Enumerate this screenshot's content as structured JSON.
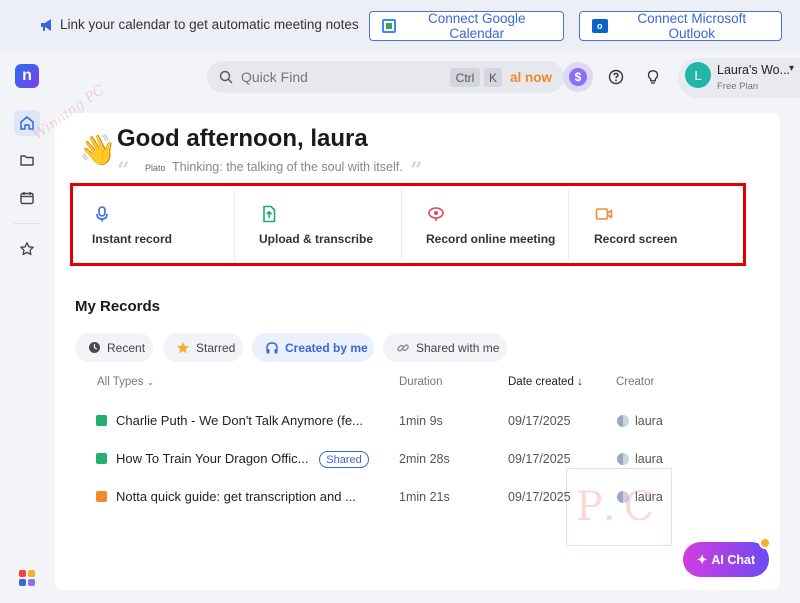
{
  "banner": {
    "text": "Link your calendar to get automatic meeting notes",
    "google_button": "Connect Google Calendar",
    "outlook_button": "Connect Microsoft Outlook"
  },
  "brand": {
    "logo_letter": "n"
  },
  "search": {
    "placeholder": "Quick Find",
    "shortcut_ctrl": "Ctrl",
    "shortcut_k": "K",
    "promo": "al now"
  },
  "user": {
    "initial": "L",
    "name": "Laura's Wo...",
    "plan": "Free Plan"
  },
  "greeting": {
    "title": "Good afternoon, laura",
    "quote_author": "Plato",
    "quote_text": "Thinking: the talking of the soul with itself."
  },
  "actions": [
    {
      "label": "Instant record",
      "icon": "microphone-icon",
      "color": "#2f6fe8"
    },
    {
      "label": "Upload & transcribe",
      "icon": "upload-icon",
      "color": "#1faa6b"
    },
    {
      "label": "Record online meeting",
      "icon": "meeting-icon",
      "color": "#e5455e"
    },
    {
      "label": "Record screen",
      "icon": "video-icon",
      "color": "#f28a2b"
    }
  ],
  "records": {
    "title": "My Records",
    "filters": [
      {
        "label": "Recent",
        "icon": "clock-icon"
      },
      {
        "label": "Starred",
        "icon": "star-icon"
      },
      {
        "label": "Created by me",
        "icon": "headphones-icon",
        "active": true
      },
      {
        "label": "Shared with me",
        "icon": "link-icon"
      }
    ],
    "columns": {
      "type": "All Types",
      "duration": "Duration",
      "date": "Date created",
      "creator": "Creator"
    },
    "rows": [
      {
        "title": "Charlie Puth - We Don't Talk Anymore (fe...",
        "duration": "1min 9s",
        "date": "09/17/2025",
        "creator": "laura",
        "type_color": "#22b06e",
        "shared": ""
      },
      {
        "title": "How To Train Your Dragon Offic...",
        "duration": "2min 28s",
        "date": "09/17/2025",
        "creator": "laura",
        "type_color": "#22b06e",
        "shared": "Shared"
      },
      {
        "title": "Notta quick guide: get transcription and ...",
        "duration": "1min 21s",
        "date": "09/17/2025",
        "creator": "laura",
        "type_color": "#f28a2b",
        "shared": ""
      }
    ]
  },
  "ai_chat": {
    "label": "AI Chat"
  },
  "watermark": {
    "text": "P.C",
    "script": "Winning PC"
  }
}
